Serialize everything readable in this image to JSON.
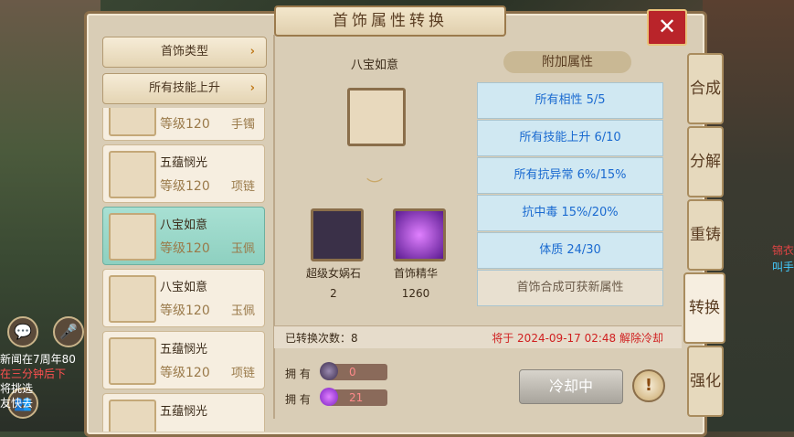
{
  "window": {
    "title": "首饰属性转换"
  },
  "left": {
    "category_label": "首饰类型",
    "skill_label": "所有技能上升",
    "items": [
      {
        "name": "",
        "level": "等级120",
        "type": "手镯"
      },
      {
        "name": "五蕴悯光",
        "level": "等级120",
        "type": "项链"
      },
      {
        "name": "八宝如意",
        "level": "等级120",
        "type": "玉佩"
      },
      {
        "name": "八宝如意",
        "level": "等级120",
        "type": "玉佩"
      },
      {
        "name": "五蕴悯光",
        "level": "等级120",
        "type": "项链"
      },
      {
        "name": "五蕴悯光",
        "level": "",
        "type": ""
      }
    ]
  },
  "center": {
    "target_name": "八宝如意",
    "materials": [
      {
        "name": "超级女娲石",
        "count": "2"
      },
      {
        "name": "首饰精华",
        "count": "1260"
      }
    ]
  },
  "attributes": {
    "header": "附加属性",
    "rows": [
      "所有相性 5/5",
      "所有技能上升 6/10",
      "所有抗异常 6%/15%",
      "抗中毒 15%/20%",
      "体质 24/30",
      "首饰合成可获新属性"
    ]
  },
  "status": {
    "conversions": "已转换次数：8",
    "cooldown": "将于 2024-09-17 02:48 解除冷却"
  },
  "owned": {
    "label": "拥 有",
    "stone_count": "0",
    "essence_count": "21"
  },
  "buttons": {
    "cooldown": "冷却中",
    "info": "!",
    "close": "✕"
  },
  "tabs": [
    "合成",
    "分解",
    "重铸",
    "转换",
    "强化"
  ],
  "background": {
    "chat": [
      "新闻在7周年80",
      "在三分钟后下",
      "将挑选",
      "友快去"
    ],
    "right_tag1": "锦衣",
    "right_tag2": "叫手"
  },
  "colors": {
    "accent": "#b9242a",
    "attr_text": "#1a6ad0",
    "cooldown_text": "#d02020"
  }
}
